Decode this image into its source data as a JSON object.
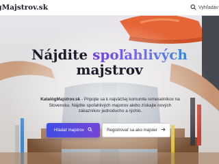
{
  "header": {
    "logo": "KatalógMajstrov.sk",
    "search_label": "Vyhľadáv"
  },
  "hero": {
    "title_line1": "Nájdite",
    "title_accent": "spoľahlivých",
    "title_line2": "majstrov",
    "description_brand": "KatalógMajstrov.sk",
    "description_text": " - Pripojte sa k najväčšej komunite remeselníkov na Slovensku. Nájdite spoľahlivých majstrov alebo získajte nových zákazníkov jednoducho a rýchlo.",
    "primary_button": "Hľadať majstrov",
    "secondary_button": "Registrovať sa ako majster"
  },
  "colors": {
    "accent_start": "#6a3fe0",
    "accent_end": "#2f88e6",
    "primary_button": "#3f4ee3",
    "text_dark": "#1c1c2a"
  },
  "icons": {
    "search": "search-icon",
    "primary_button_icon": "search-icon",
    "secondary_button_icon": "arrow-right-icon"
  }
}
